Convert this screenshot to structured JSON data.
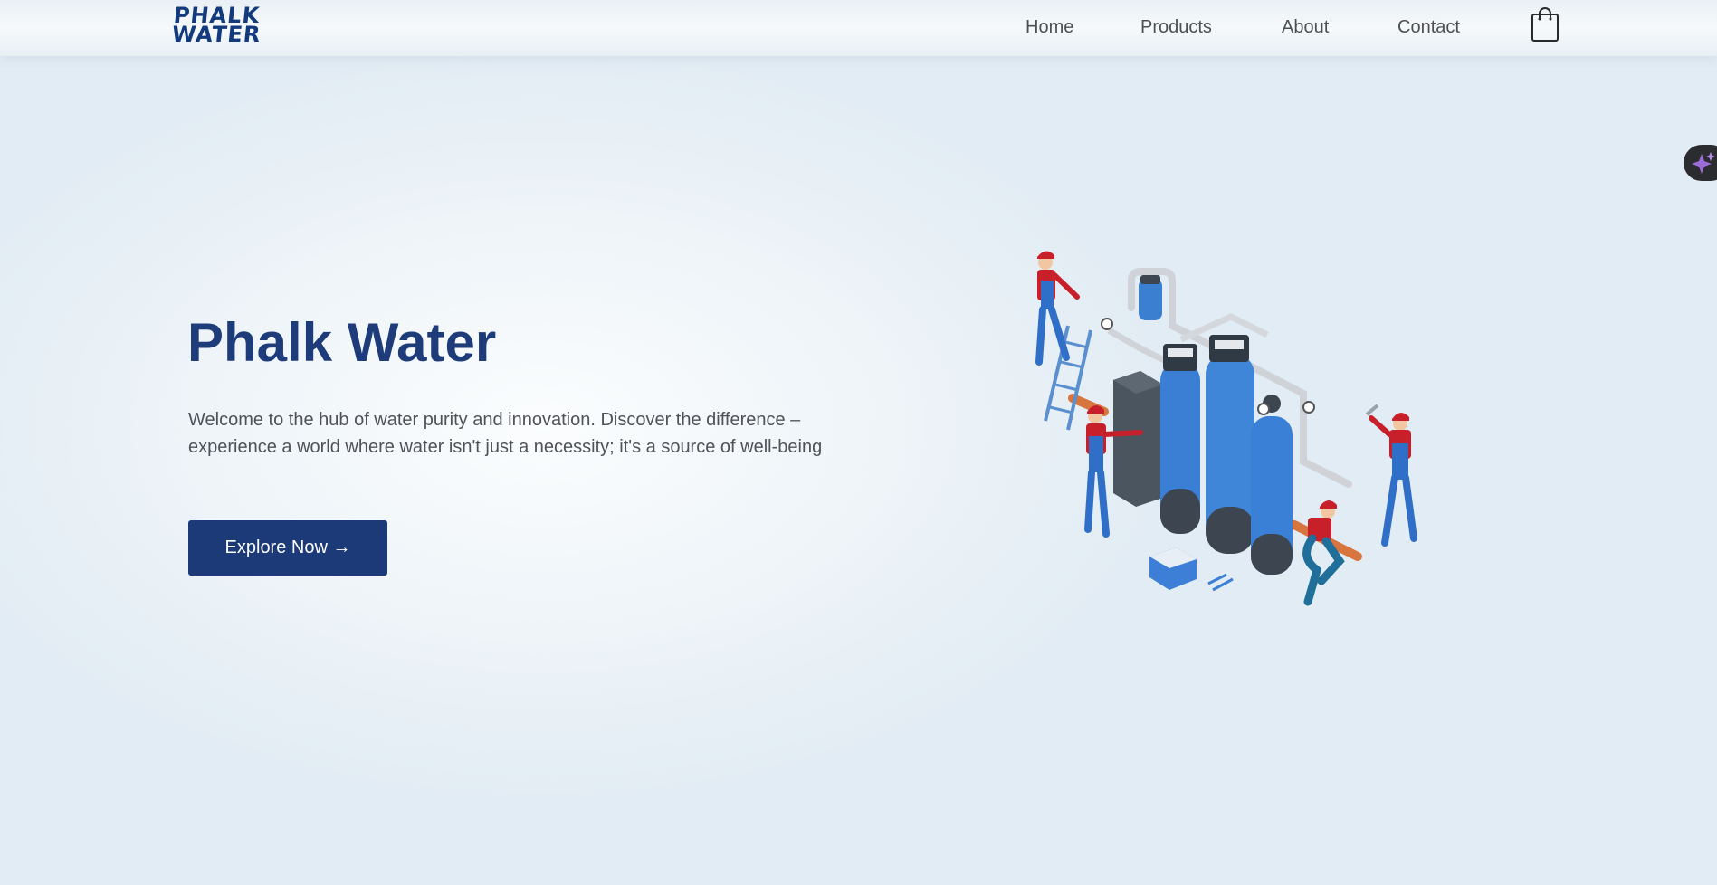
{
  "header": {
    "logo": {
      "line1": "PHALK",
      "line2": "WATER"
    },
    "nav": [
      {
        "label": "Home"
      },
      {
        "label": "Products"
      },
      {
        "label": "About"
      },
      {
        "label": "Contact"
      }
    ],
    "cart_icon": "shopping-bag-icon"
  },
  "floating_button": {
    "icon": "sparkles-icon"
  },
  "hero": {
    "title": "Phalk Water",
    "description": "Welcome to the hub of water purity and innovation. Discover the difference – experience a world where water isn't just a necessity; it's a source of well-being",
    "cta_label": "Explore Now →",
    "illustration": "water-treatment-workers-illustration"
  },
  "colors": {
    "brand": "#1d3a78",
    "text": "#505258",
    "background": "#eef4f8"
  }
}
